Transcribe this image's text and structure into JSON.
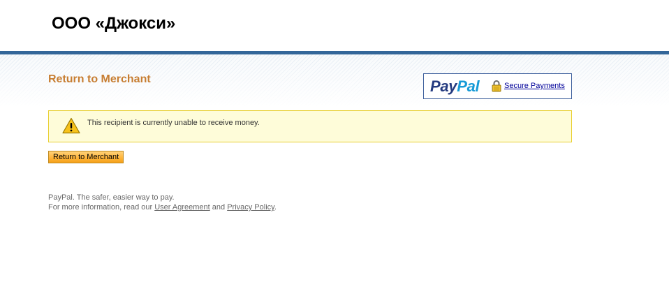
{
  "header": {
    "merchant_name": "ООО «Джокси»"
  },
  "page": {
    "title": "Return to Merchant"
  },
  "badge": {
    "logo_pay": "Pay",
    "logo_pal": "Pal",
    "secure_link": "Secure Payments",
    "lock_icon": "padlock-icon"
  },
  "alert": {
    "icon": "warning-triangle-icon",
    "message": "This recipient is currently unable to receive money."
  },
  "actions": {
    "return_button": "Return to Merchant"
  },
  "footer": {
    "tagline": "PayPal. The safer, easier way to pay.",
    "info_prefix": "For more information, read our ",
    "user_agreement": "User Agreement",
    "and": " and ",
    "privacy_policy": "Privacy Policy",
    "period": "."
  },
  "colors": {
    "header_rule": "#336699",
    "title": "#c77e32",
    "alert_border": "#e8cf30",
    "alert_bg": "#fefcd9",
    "button": "#ffb53c",
    "paypal_dark": "#253b80",
    "paypal_light": "#179bd7"
  }
}
